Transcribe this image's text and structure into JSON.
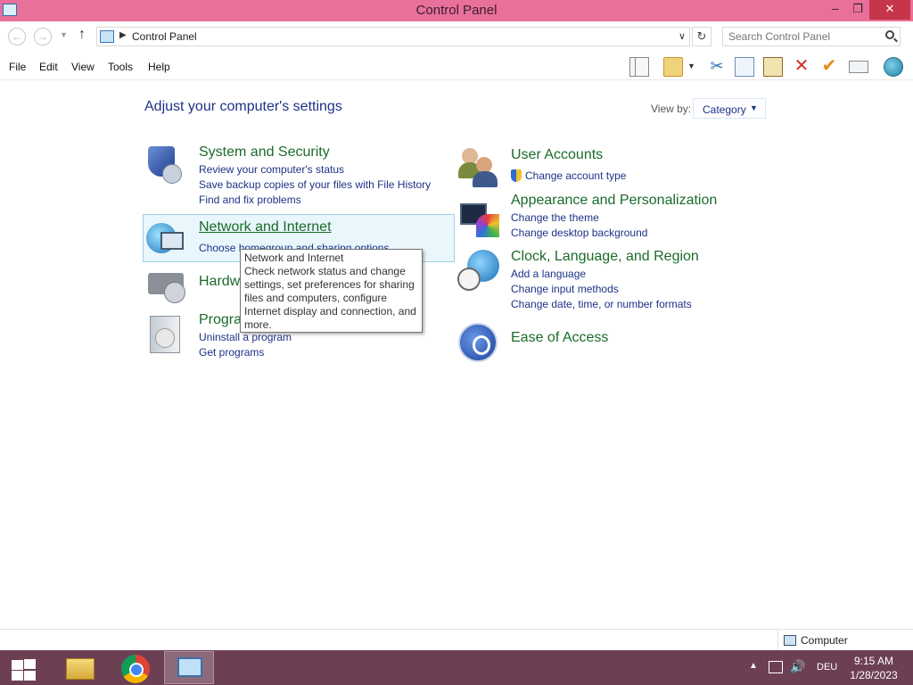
{
  "window": {
    "title": "Control Panel",
    "controls": {
      "minimize": "–",
      "maximize": "❐",
      "close": "✕"
    }
  },
  "address": {
    "path": "Control Panel",
    "search_placeholder": "Search Control Panel"
  },
  "menu": [
    "File",
    "Edit",
    "View",
    "Tools",
    "Help"
  ],
  "main": {
    "heading": "Adjust your computer's settings",
    "view_by_label": "View by:",
    "view_by_value": "Category"
  },
  "categories": {
    "system_security": {
      "title": "System and Security",
      "links": [
        "Review your computer's status",
        "Save backup copies of your files with File History",
        "Find and fix problems"
      ]
    },
    "network_internet": {
      "title": "Network and Internet",
      "links": [
        "Choose homegroup and sharing options"
      ]
    },
    "hardware_sound": {
      "title": "Hardware and Sound"
    },
    "programs": {
      "title": "Programs",
      "links": [
        "Uninstall a program",
        "Get programs"
      ]
    },
    "user_accounts": {
      "title": "User Accounts",
      "links": [
        "Change account type"
      ]
    },
    "appearance": {
      "title": "Appearance and Personalization",
      "links": [
        "Change the theme",
        "Change desktop background"
      ]
    },
    "clock_region": {
      "title": "Clock, Language, and Region",
      "links": [
        "Add a language",
        "Change input methods",
        "Change date, time, or number formats"
      ]
    },
    "ease_access": {
      "title": "Ease of Access"
    }
  },
  "tooltip": {
    "lines": [
      "Network and Internet",
      "Check network status and change",
      "settings, set preferences for sharing",
      "files and computers, configure",
      "Internet display and connection, and",
      "more."
    ]
  },
  "status": {
    "computer": "Computer"
  },
  "taskbar": {
    "language": "DEU",
    "time": "9:15 AM",
    "date": "1/28/2023"
  }
}
